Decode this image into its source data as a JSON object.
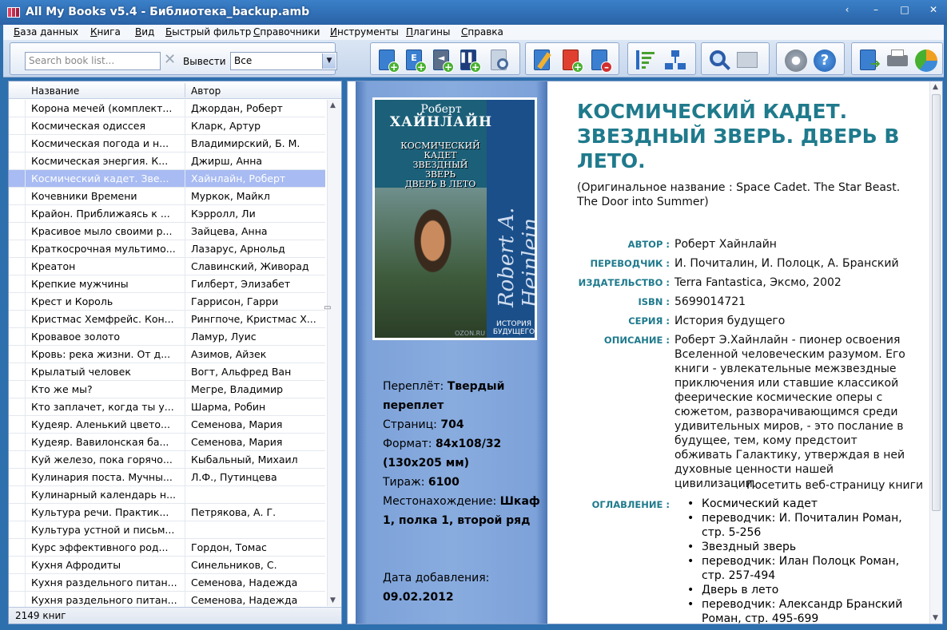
{
  "window": {
    "title": "All My Books v5.4 - Библиотека_backup.amb",
    "controls": [
      "‹",
      "–",
      "□",
      "✕"
    ]
  },
  "menu": {
    "items": [
      "База данных",
      "Книга",
      "Вид",
      "Быстрый фильтр",
      "Справочники",
      "Инструменты",
      "Плагины",
      "Справка"
    ]
  },
  "toolbar": {
    "search_placeholder": "Search book list...",
    "show_label": "Вывести",
    "filter_value": "Все"
  },
  "book_list": {
    "columns": [
      "Название",
      "Автор"
    ],
    "rows": [
      {
        "title": "Корона мечей (комплект...",
        "author": "Джордан, Роберт"
      },
      {
        "title": "Космическая одиссея",
        "author": "Кларк, Артур"
      },
      {
        "title": "Космическая погода и н...",
        "author": "Владимирский, Б. М."
      },
      {
        "title": "Космическая энергия. К...",
        "author": "Джирш, Анна"
      },
      {
        "title": "Космический кадет. Зве...",
        "author": "Хайнлайн, Роберт"
      },
      {
        "title": "Кочевники Времени",
        "author": "Муркок, Майкл"
      },
      {
        "title": "Крайон. Приближаясь к ...",
        "author": "Кэрролл, Ли"
      },
      {
        "title": "Красивое мыло своими р...",
        "author": "Зайцева, Анна"
      },
      {
        "title": "Краткосрочная мультимо...",
        "author": "Лазарус, Арнольд"
      },
      {
        "title": "Креатон",
        "author": "Славинский, Живорад"
      },
      {
        "title": "Крепкие мужчины",
        "author": "Гилберт, Элизабет"
      },
      {
        "title": "Крест и Король",
        "author": "Гаррисон, Гарри"
      },
      {
        "title": "Кристмас Хемфрейс. Кон...",
        "author": "Рингпоче, Кристмас Х..."
      },
      {
        "title": "Кровавое золото",
        "author": "Ламур, Луис"
      },
      {
        "title": "Кровь: река жизни. От д...",
        "author": "Азимов, Айзек"
      },
      {
        "title": "Крылатый человек",
        "author": "Вогт, Альфред Ван"
      },
      {
        "title": "Кто же мы?",
        "author": "Мегре, Владимир"
      },
      {
        "title": "Кто заплачет, когда ты у...",
        "author": "Шарма, Робин"
      },
      {
        "title": "Кудеяр. Аленький цвето...",
        "author": "Семенова, Мария"
      },
      {
        "title": "Кудеяр. Вавилонская ба...",
        "author": "Семенова, Мария"
      },
      {
        "title": "Куй железо, пока горячо...",
        "author": "Кыбальный, Михаил"
      },
      {
        "title": "Кулинария поста. Мучны...",
        "author": "Л.Ф., Путинцева"
      },
      {
        "title": "Кулинарный календарь н...",
        "author": ""
      },
      {
        "title": "Культура речи. Практик...",
        "author": "Петрякова, А. Г."
      },
      {
        "title": "Культура устной и письм...",
        "author": ""
      },
      {
        "title": "Курс эффективного род...",
        "author": "Гордон, Томас"
      },
      {
        "title": "Кухня Афродиты",
        "author": "Синельников, С."
      },
      {
        "title": "Кухня раздельного питан...",
        "author": "Семенова, Надежда"
      },
      {
        "title": "Кухня раздельного питан...",
        "author": "Семенова, Надежда"
      }
    ],
    "selected_index": 4,
    "status": "2149 книг"
  },
  "cover": {
    "author_first": "Роберт",
    "author_last": "ХАЙНЛАЙН",
    "title_lines": [
      "КОСМИЧЕСКИЙ",
      "КАДЕТ",
      "ЗВЕЗДНЫЙ",
      "ЗВЕРЬ",
      "ДВЕРЬ В ЛЕТО"
    ],
    "signature": "Robert A. Heinlein",
    "series": "ИСТОРИЯ БУДУЩЕГО",
    "watermark": "OZON.RU"
  },
  "specs": {
    "binding_label": "Переплёт: ",
    "binding_value": "Твердый переплет",
    "pages_label": "Страниц: ",
    "pages_value": "704",
    "format_label": "Формат: ",
    "format_value": "84x108/32 (130x205 мм)",
    "print_label": "Тираж: ",
    "print_value": "6100",
    "location_label": "Местонахождение: ",
    "location_value": "Шкаф 1, полка 1, второй ряд",
    "added_label": "Дата добавления:",
    "added_value": "09.02.2012"
  },
  "details": {
    "title": "КОСМИЧЕСКИЙ КАДЕТ. ЗВЕЗДНЫЙ ЗВЕРЬ. ДВЕРЬ В ЛЕТО.",
    "original_name": "(Оригинальное название : Space Cadet. The Star Beast. The Door into Summer)",
    "author_label": "АВТОР :",
    "author_value": "Роберт Хайнлайн",
    "translator_label": "ПЕРЕВОДЧИК :",
    "translator_value": "И. Почиталин, И. Полоцк, А. Бранский",
    "publisher_label": "ИЗДАТЕЛЬСТВО :",
    "publisher_value": "Terra Fantastica, Эксмо, 2002",
    "isbn_label": "ISBN :",
    "isbn_value": "5699014721",
    "series_label": "СЕРИЯ :",
    "series_value": "История будущего",
    "description_label": "ОПИСАНИЕ :",
    "description_value": "Роберт Э.Хайнлайн - пионер освоения Вселенной человеческим разумом. Его книги - увлекательные межзвездные приключения или ставшие классикой феерические космические оперы с сюжетом, разворачивающимся среди удивительных миров, - это послание в будущее, тем, кому предстоит обживать Галактику, утверждая в ней духовные ценности нашей цивилизации.",
    "web_link": "Посетить веб-страницу книги",
    "toc_label": "ОГЛАВЛЕНИЕ :",
    "toc": [
      "Космический кадет",
      "переводчик: И. Почиталин Роман, стр. 5-256",
      "Звездный зверь",
      "переводчик: Илан Полоцк Роман, стр. 257-494",
      "Дверь в лето",
      "переводчик: Александр Бранский Роман, стр. 495-699"
    ]
  }
}
